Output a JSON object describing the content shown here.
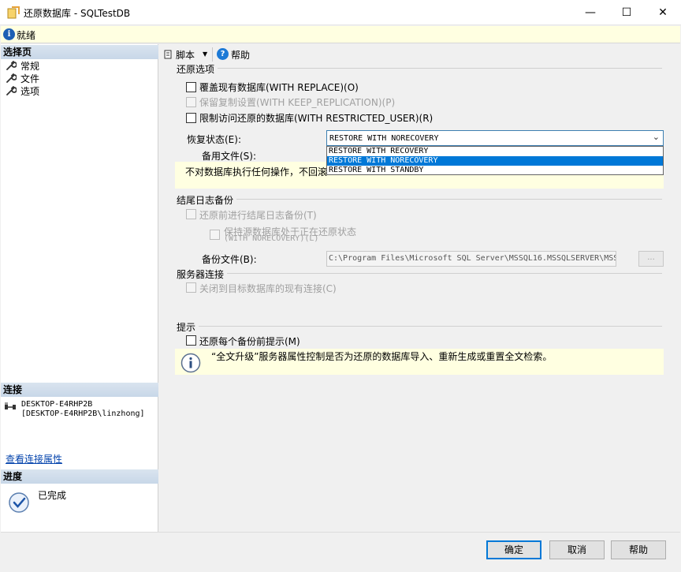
{
  "window": {
    "title": "还原数据库 - SQLTestDB",
    "minimize": "—",
    "maximize": "☐",
    "close": "✕"
  },
  "status": {
    "text": "就绪"
  },
  "left": {
    "select_page_header": "选择页",
    "pages": [
      "常规",
      "文件",
      "选项"
    ],
    "connection_header": "连接",
    "server": "DESKTOP-E4RHP2B",
    "user": "[DESKTOP-E4RHP2B\\linzhong]",
    "view_connection_link": "查看连接属性",
    "progress_header": "进度",
    "progress_text": "已完成"
  },
  "toolbar": {
    "script": "脚本",
    "help": "帮助"
  },
  "restore_options": {
    "title": "还原选项",
    "overwrite": "覆盖现有数据库(WITH REPLACE)(O)",
    "keep_replication": "保留复制设置(WITH KEEP_REPLICATION)(P)",
    "restricted_user": "限制访问还原的数据库(WITH RESTRICTED_USER)(R)",
    "recovery_state_label": "恢复状态(E):",
    "recovery_state_value": "RESTORE WITH NORECOVERY",
    "recovery_options": [
      "RESTORE WITH RECOVERY",
      "RESTORE WITH NORECOVERY",
      "RESTORE WITH STANDBY"
    ],
    "selected_option_index": 1,
    "standby_file_label": "备用文件(S):",
    "description": "不对数据库执行任何操作，不回滚"
  },
  "tail_log": {
    "title": "结尾日志备份",
    "take_tail_log": "还原前进行结尾日志备份(T)",
    "leave_norecovery_line1": "保持源数据库处于正在还原状态",
    "leave_norecovery_line2": "(WITH NORECOVERY)(L)",
    "backup_file_label": "备份文件(B):",
    "backup_file_value": "C:\\Program Files\\Microsoft SQL Server\\MSSQL16.MSSQLSERVER\\MSS",
    "browse": "..."
  },
  "server_connections": {
    "title": "服务器连接",
    "close_existing": "关闭到目标数据库的现有连接(C)"
  },
  "prompt": {
    "title": "提示",
    "prompt_before_each": "还原每个备份前提示(M)",
    "info": "“全文升级”服务器属性控制是否为还原的数据库导入、重新生成或重置全文检索。"
  },
  "buttons": {
    "ok": "确定",
    "cancel": "取消",
    "help": "帮助"
  }
}
